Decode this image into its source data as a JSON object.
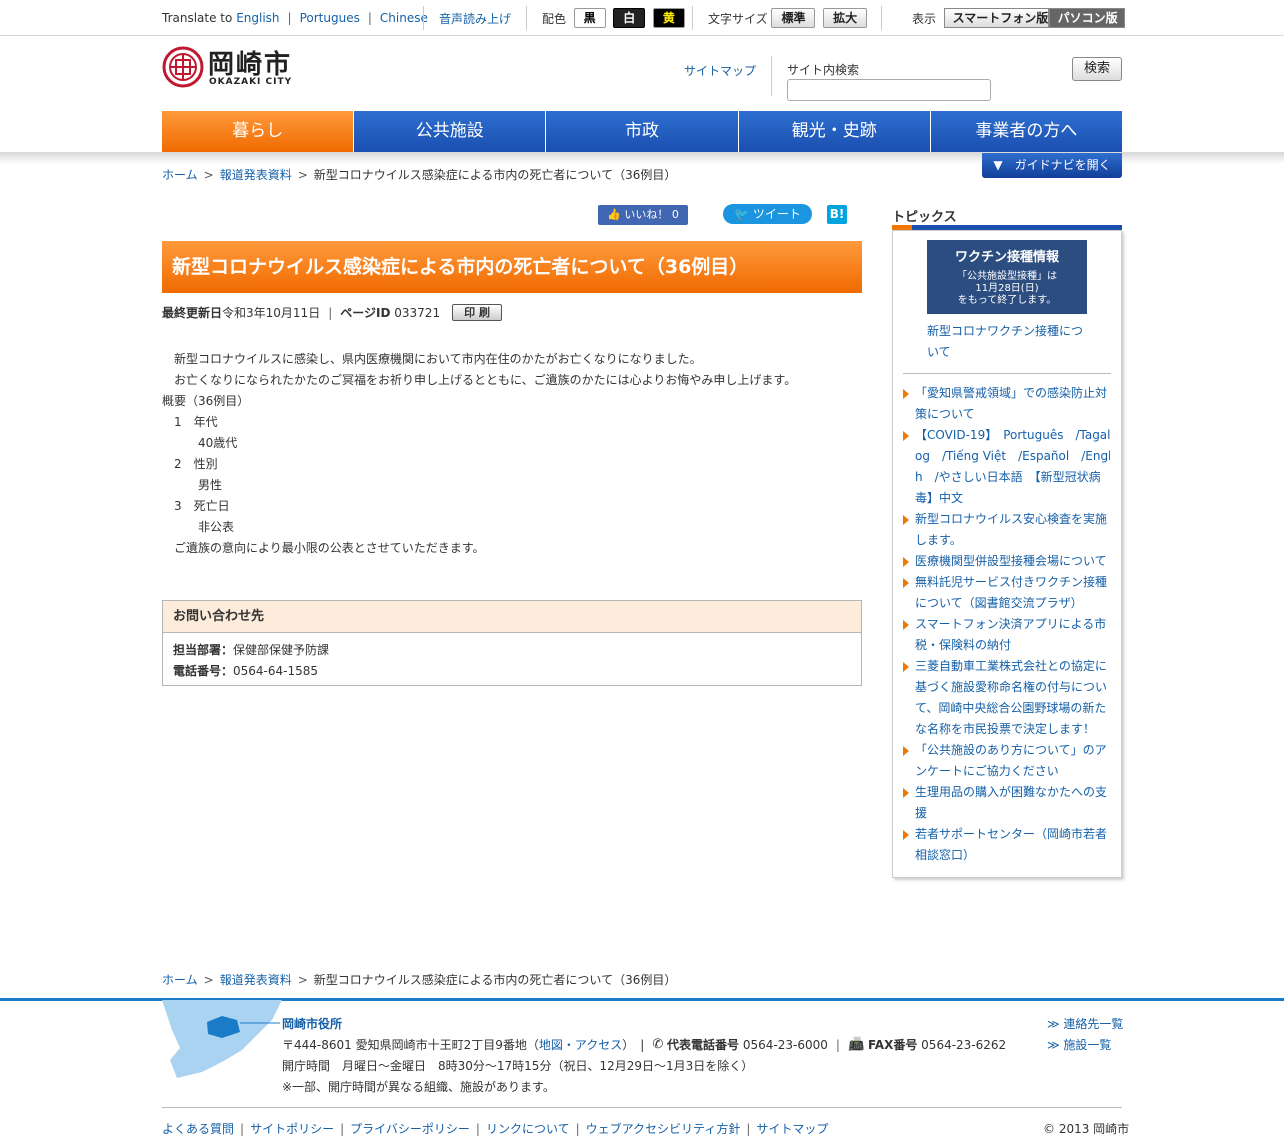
{
  "topbar": {
    "translate_label": "Translate to",
    "translate_links": [
      "English",
      "Portugues",
      "Chinese"
    ],
    "readout_label": "音声読み上げ",
    "color_label": "配色",
    "color_buttons": [
      "黒",
      "白",
      "黄"
    ],
    "fontsize_label": "文字サイズ",
    "fontsize_buttons": [
      "標準",
      "拡大"
    ],
    "display_label": "表示",
    "display_buttons": [
      "スマートフォン版",
      "パソコン版"
    ]
  },
  "header": {
    "logo_text": "岡崎市",
    "logo_sub": "OKAZAKI CITY",
    "sitemap_link": "サイトマップ",
    "search_label": "サイト内検索",
    "search_button": "検索"
  },
  "gnav": [
    "暮らし",
    "公共施設",
    "市政",
    "観光・史跡",
    "事業者の方へ"
  ],
  "breadcrumb": [
    "ホーム",
    "報道発表資料",
    "新型コロナウイルス感染症による市内の死亡者について（36例目）"
  ],
  "guide_button": "▼　ガイドナビを開く",
  "social": {
    "like": "いいね！ 0",
    "tweet": "ツイート",
    "hatena": "B!"
  },
  "article": {
    "title": "新型コロナウイルス感染症による市内の死亡者について（36例目）",
    "updated_label": "最終更新日",
    "updated_value": "令和3年10月11日",
    "pageid_label": "ページID",
    "pageid_value": "033721",
    "print_button": "印 刷",
    "lines": [
      "新型コロナウイルスに感染し、県内医療機関において市内在住のかたがお亡くなりになりました。",
      "お亡くなりになられたかたのご冥福をお祈り申し上げるとともに、ご遺族のかたには心よりお悔やみ申し上げます。",
      "概要（36例目）",
      "1　年代",
      "40歳代",
      "2　性別",
      "男性",
      "3　死亡日",
      "非公表",
      "ご遺族の意向により最小限の公表とさせていただきます。"
    ]
  },
  "contact": {
    "heading": "お問い合わせ先",
    "dept_label": "担当部署：",
    "dept_value": "保健部保健予防課",
    "tel_label": "電話番号：",
    "tel_value": "0564-64-1585"
  },
  "topics": {
    "heading": "トピックス",
    "banner_title": "ワクチン接種情報",
    "banner_sub": [
      "「公共施設型接種」は",
      "11月28日(日)",
      "をもって終了します。"
    ],
    "banner_link": [
      "新型コロナワクチン接種につ",
      "いて"
    ],
    "items": [
      [
        "「愛知県警戒領域」での感染防止対",
        "策について"
      ],
      [
        "【COVID-19】　Português　/Tagal",
        "og　/Tiếng Việt　/Español　/Englis",
        "h　/やさしい日本語　【新型冠状病",
        "毒】中文"
      ],
      [
        "新型コロナウイルス安心検査を実施",
        "します。"
      ],
      [
        "医療機関型併設型接種会場について"
      ],
      [
        "無料託児サービス付きワクチン接種",
        "について（図書館交流プラザ）"
      ],
      [
        "スマートフォン決済アプリによる市",
        "税・保険料の納付"
      ],
      [
        "三菱自動車工業株式会社との協定に",
        "基づく施設愛称命名権の付与につい",
        "て、岡崎中央総合公園野球場の新た",
        "な名称を市民投票で決定します！"
      ],
      [
        "「公共施設のあり方について」のア",
        "ンケートにご協力ください"
      ],
      [
        "生理用品の購入が困難なかたへの支",
        "援"
      ],
      [
        "若者サポートセンター（岡崎市若者",
        "相談窓口）"
      ]
    ]
  },
  "footer": {
    "office_name": "岡崎市役所",
    "address": "〒444-8601 愛知県岡崎市十王町2丁目9番地（",
    "access_link": "地図・アクセス",
    "address_end": "）　|",
    "tel_label": "代表電話番号",
    "tel_value": "0564-23-6000",
    "fax_label": "FAX番号",
    "fax_value": "0564-23-6262",
    "hours": "開庁時間　月曜日～金曜日　8時30分～17時15分（祝日、12月29日～1月3日を除く）",
    "note": "※一部、開庁時間が異なる組織、施設があります。",
    "side_links": [
      "≫ 連絡先一覧",
      "≫ 施設一覧"
    ],
    "bottom_links": [
      "よくある質問",
      "サイトポリシー",
      "プライバシーポリシー",
      "リンクについて",
      "ウェブアクセシビリティ方針",
      "サイトマップ"
    ],
    "copyright": "© 2013 岡崎市"
  }
}
